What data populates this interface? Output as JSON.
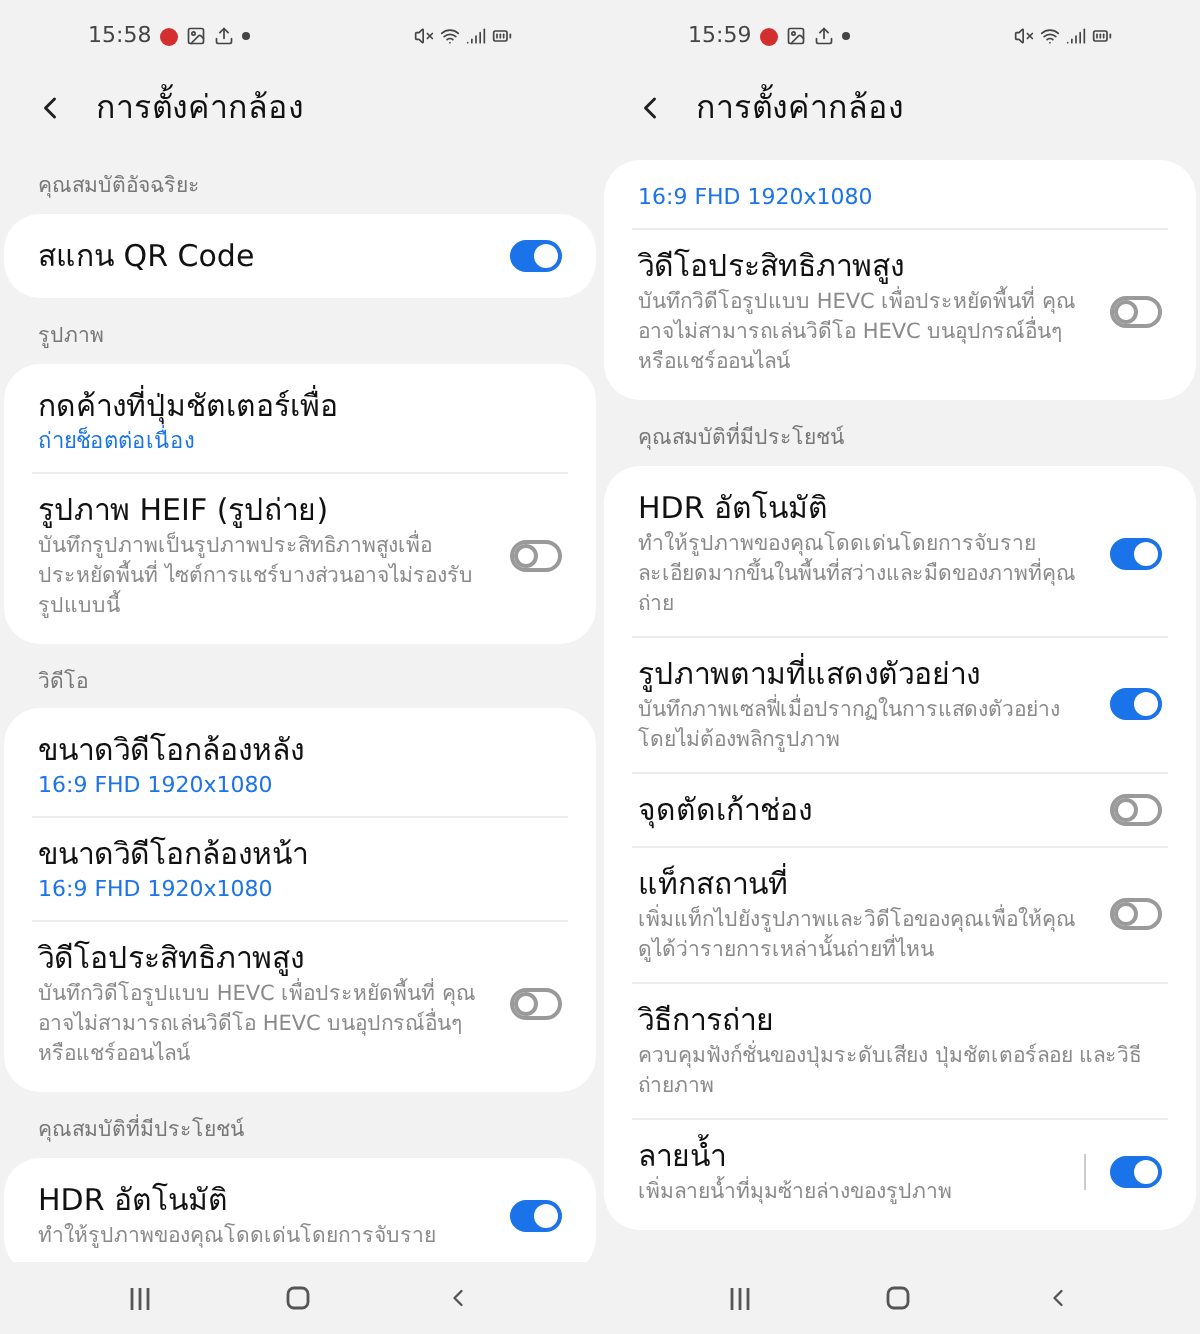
{
  "phones": [
    {
      "status_bar": {
        "time": "15:58"
      },
      "header": {
        "title": "การตั้งค่ากล้อง"
      },
      "sections": [
        {
          "label": "คุณสมบัติอัจฉริยะ",
          "items": [
            {
              "kind": "toggle",
              "title": "สแกน QR Code",
              "on": true
            }
          ]
        },
        {
          "label": "รูปภาพ",
          "items": [
            {
              "kind": "value",
              "title": "กดค้างที่ปุ่มชัตเตอร์เพื่อ",
              "value": "ถ่ายช็อตต่อเนื่อง"
            },
            {
              "kind": "toggle",
              "title": "รูปภาพ HEIF (รูปถ่าย)",
              "description": "บันทึกรูปภาพเป็นรูปภาพประสิทธิภาพสูงเพื่อประหยัดพื้นที่ ไซต์การแชร์บางส่วนอาจไม่รองรับรูปแบบนี้",
              "on": false
            }
          ]
        },
        {
          "label": "วิดีโอ",
          "items": [
            {
              "kind": "value",
              "title": "ขนาดวิดีโอกล้องหลัง",
              "value": "16:9 FHD 1920x1080"
            },
            {
              "kind": "value",
              "title": "ขนาดวิดีโอกล้องหน้า",
              "value": "16:9 FHD 1920x1080"
            },
            {
              "kind": "toggle",
              "title": "วิดีโอประสิทธิภาพสูง",
              "description": "บันทึกวิดีโอรูปแบบ HEVC เพื่อประหยัดพื้นที่ คุณอาจไม่สามารถเล่นวิดีโอ HEVC บนอุปกรณ์อื่นๆ หรือแชร์ออนไลน์",
              "on": false
            }
          ]
        },
        {
          "label": "คุณสมบัติที่มีประโยชน์",
          "items": [
            {
              "kind": "toggle",
              "title": "HDR อัตโนมัติ",
              "description": "ทำให้รูปภาพของคุณโดดเด่นโดยการจับราย",
              "on": true
            }
          ]
        }
      ]
    },
    {
      "status_bar": {
        "time": "15:59"
      },
      "header": {
        "title": "การตั้งค่ากล้อง"
      },
      "sections": [
        {
          "items": [
            {
              "kind": "value",
              "value": "16:9 FHD 1920x1080"
            },
            {
              "kind": "toggle",
              "title": "วิดีโอประสิทธิภาพสูง",
              "description": "บันทึกวิดีโอรูปแบบ HEVC เพื่อประหยัดพื้นที่ คุณอาจไม่สามารถเล่นวิดีโอ HEVC บนอุปกรณ์อื่นๆ หรือแชร์ออนไลน์",
              "on": false
            }
          ]
        },
        {
          "label": "คุณสมบัติที่มีประโยชน์",
          "items": [
            {
              "kind": "toggle",
              "title": "HDR อัตโนมัติ",
              "description": "ทำให้รูปภาพของคุณโดดเด่นโดยการจับรายละเอียดมากขึ้นในพื้นที่สว่างและมืดของภาพที่คุณถ่าย",
              "on": true
            },
            {
              "kind": "toggle",
              "title": "รูปภาพตามที่แสดงตัวอย่าง",
              "description": "บันทึกภาพเซลฟี่เมื่อปรากฏในการแสดงตัวอย่างโดยไม่ต้องพลิกรูปภาพ",
              "on": true
            },
            {
              "kind": "toggle",
              "title": "จุดตัดเก้าช่อง",
              "on": false
            },
            {
              "kind": "toggle",
              "title": "แท็กสถานที่",
              "description": "เพิ่มแท็กไปยังรูปภาพและวิดีโอของคุณเพื่อให้คุณดูได้ว่ารายการเหล่านั้นถ่ายที่ไหน",
              "on": false
            },
            {
              "kind": "link",
              "title": "วิธีการถ่าย",
              "description": "ควบคุมฟังก์ชั่นของปุ่มระดับเสียง ปุ่มชัตเตอร์ลอย และวิธีถ่ายภาพ"
            },
            {
              "kind": "split_toggle",
              "title": "ลายน้ำ",
              "description": "เพิ่มลายน้ำที่มุมซ้ายล่างของรูปภาพ",
              "on": true
            }
          ]
        }
      ]
    }
  ]
}
